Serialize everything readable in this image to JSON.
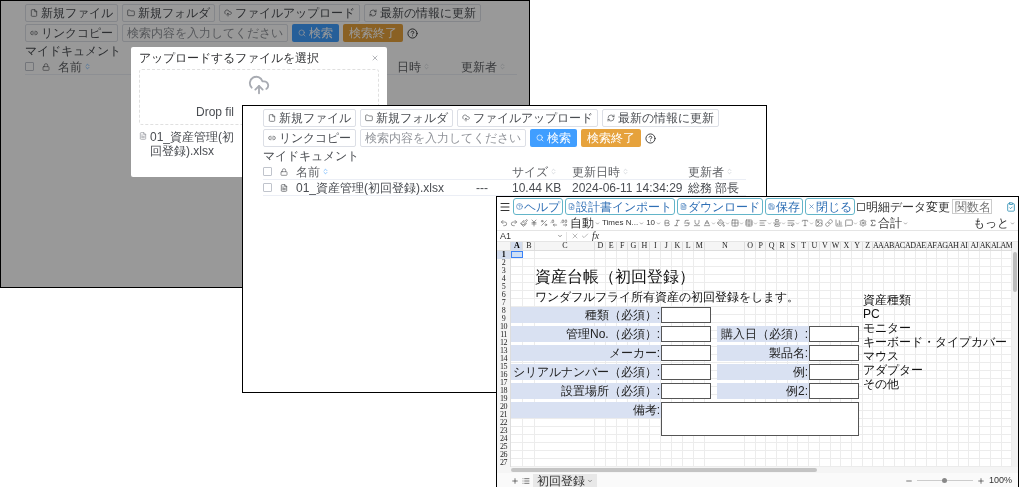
{
  "upload_screen": {
    "toolbar": {
      "buttons": [
        "新規ファイル",
        "新規フォルダ",
        "ファイルアップロード",
        "最新の情報に更新",
        "リンクコピー"
      ],
      "search": {
        "placeholder": "検索内容を入力してください"
      },
      "search_button": "検索",
      "clear_button": "検索終了"
    },
    "breadcrumb": "マイドキュメント",
    "table": {
      "select_all": {
        "checked": false
      },
      "columns": [
        {
          "kind": "name",
          "label": "名前",
          "sorted": true
        },
        {
          "kind": "date",
          "label": "日時",
          "sorted": false
        },
        {
          "kind": "user",
          "label": "更新者",
          "sorted": false
        }
      ]
    },
    "modal": {
      "title": "アップロードするファイルを選択",
      "drop_text": "Drop fil",
      "files": [
        "01_資産管理(初回登録).xlsx"
      ]
    }
  },
  "file_list_screen": {
    "toolbar": {
      "buttons": [
        "新規ファイル",
        "新規フォルダ",
        "ファイルアップロード",
        "最新の情報に更新",
        "リンクコピー"
      ],
      "search": {
        "placeholder": "検索内容を入力してください"
      },
      "search_button": "検索",
      "clear_button": "検索終了"
    },
    "breadcrumb": "マイドキュメント",
    "table": {
      "select_all": {
        "checked": false
      },
      "columns": [
        {
          "kind": "name",
          "label": "名前",
          "sorted": true
        },
        {
          "kind": "blank"
        },
        {
          "kind": "size",
          "label": "サイズ",
          "sorted": false
        },
        {
          "kind": "date",
          "label": "更新日時",
          "sorted": false
        },
        {
          "kind": "user",
          "label": "更新者",
          "sorted": false
        }
      ],
      "rows": [
        {
          "checked": false,
          "cells": [
            "01_資産管理(初回登録).xlsx",
            "---",
            "10.44 KB",
            "2024-06-11 14:34:29",
            "総務 部長"
          ]
        }
      ]
    }
  },
  "spreadsheet_screen": {
    "buttons": [
      "ヘルプ",
      "設計書インポート",
      "ダウンロード",
      "保存",
      "閉じる"
    ],
    "detail_checkbox": {
      "label": "明細データ変更",
      "checked": false
    },
    "function_field": {
      "placeholder": "関数名"
    },
    "format_toolbar": {
      "number_format": "自動",
      "font": "Times N...",
      "font_size": "10",
      "sum": "合計",
      "more": "もっと"
    },
    "cell_ref": "A1",
    "formula_label": "fx",
    "columns": [
      {
        "label": "A",
        "selected": true
      },
      {
        "label": "B",
        "selected": false
      },
      {
        "label": "C",
        "selected": false
      },
      {
        "label": "D",
        "selected": false
      },
      {
        "label": "E",
        "selected": false
      },
      {
        "label": "F",
        "selected": false
      },
      {
        "label": "G",
        "selected": false
      },
      {
        "label": "H",
        "selected": false
      },
      {
        "label": "I",
        "selected": false
      },
      {
        "label": "J",
        "selected": false
      },
      {
        "label": "K",
        "selected": false
      },
      {
        "label": "L",
        "selected": false
      },
      {
        "label": "M",
        "selected": false
      },
      {
        "label": "N",
        "selected": false
      },
      {
        "label": "O",
        "selected": false
      },
      {
        "label": "P",
        "selected": false
      },
      {
        "label": "Q",
        "selected": false
      },
      {
        "label": "R",
        "selected": false
      },
      {
        "label": "S",
        "selected": false
      },
      {
        "label": "T",
        "selected": false
      },
      {
        "label": "U",
        "selected": false
      },
      {
        "label": "V",
        "selected": false
      },
      {
        "label": "W",
        "selected": false
      },
      {
        "label": "X",
        "selected": false
      },
      {
        "label": "Y",
        "selected": false
      },
      {
        "label": "Z",
        "selected": false
      },
      {
        "label": "AA",
        "selected": false
      },
      {
        "label": "AB",
        "selected": false
      },
      {
        "label": "AC",
        "selected": false
      },
      {
        "label": "AD",
        "selected": false
      },
      {
        "label": "AE",
        "selected": false
      },
      {
        "label": "AF",
        "selected": false
      },
      {
        "label": "AG",
        "selected": false
      },
      {
        "label": "AH",
        "selected": false
      },
      {
        "label": "AI",
        "selected": false
      },
      {
        "label": "AJ",
        "selected": false
      },
      {
        "label": "AK",
        "selected": false
      },
      {
        "label": "AL",
        "selected": false
      },
      {
        "label": "AM",
        "selected": false
      }
    ],
    "rows": [
      {
        "label": "1",
        "selected": true
      },
      {
        "label": "2",
        "selected": false
      },
      {
        "label": "3",
        "selected": false
      },
      {
        "label": "4",
        "selected": false
      },
      {
        "label": "5",
        "selected": false
      },
      {
        "label": "6",
        "selected": false
      },
      {
        "label": "7",
        "selected": false
      },
      {
        "label": "8",
        "selected": false
      },
      {
        "label": "9",
        "selected": false
      },
      {
        "label": "10",
        "selected": false
      },
      {
        "label": "11",
        "selected": false
      },
      {
        "label": "12",
        "selected": false
      },
      {
        "label": "13",
        "selected": false
      },
      {
        "label": "14",
        "selected": false
      },
      {
        "label": "15",
        "selected": false
      },
      {
        "label": "16",
        "selected": false
      },
      {
        "label": "17",
        "selected": false
      },
      {
        "label": "18",
        "selected": false
      },
      {
        "label": "19",
        "selected": false
      },
      {
        "label": "20",
        "selected": false
      },
      {
        "label": "21",
        "selected": false
      },
      {
        "label": "22",
        "selected": false
      },
      {
        "label": "23",
        "selected": false
      },
      {
        "label": "24",
        "selected": false
      },
      {
        "label": "25",
        "selected": false
      },
      {
        "label": "26",
        "selected": false
      },
      {
        "label": "27",
        "selected": false
      }
    ],
    "title": "資産台帳（初回登録）",
    "description": "ワンダフルフライ所有資産の初回登録をします。",
    "form_rows": [
      [
        {
          "label": "種類（必須）:",
          "kind": "input"
        }
      ],
      [
        {
          "label": "管理No.（必須）:",
          "kind": "input"
        },
        {
          "label": "購入日（必須）:",
          "kind": "input"
        }
      ],
      [
        {
          "label": "メーカー:",
          "kind": "input"
        },
        {
          "label": "製品名:",
          "kind": "input"
        }
      ],
      [
        {
          "label": "シリアルナンバー（必須）:",
          "kind": "input"
        },
        {
          "label": "例:",
          "kind": "input"
        }
      ],
      [
        {
          "label": "設置場所（必須）:",
          "kind": "input"
        },
        {
          "label": "例2:",
          "kind": "input"
        }
      ],
      [
        {
          "label": "備考:",
          "kind": "textarea"
        }
      ]
    ],
    "asset_types": {
      "heading": "資産種類",
      "items": [
        "PC",
        "モニター",
        "キーボード・タイプカバー",
        "マウス",
        "アダプター",
        "その他"
      ]
    },
    "sheet_tabs": [
      {
        "label": "初回登録",
        "selected": true
      }
    ],
    "zoom": {
      "level": 0.5,
      "label": "100%"
    }
  }
}
